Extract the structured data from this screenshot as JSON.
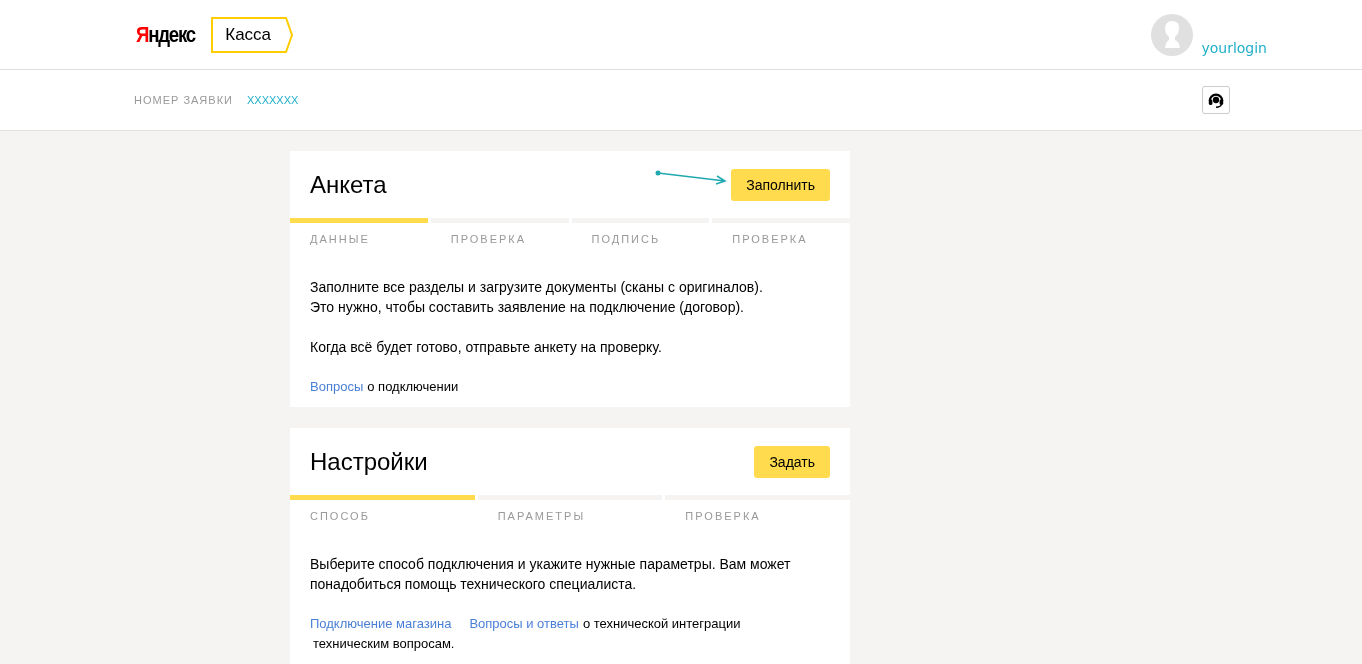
{
  "header": {
    "logo": {
      "first_letter": "Я",
      "rest": "ндекс"
    },
    "service": "Касса",
    "user": {
      "login": "yourlogin"
    }
  },
  "subheader": {
    "label": "НОМЕР ЗАЯВКИ",
    "number": "XXXXXXX"
  },
  "cards": [
    {
      "title": "Анкета",
      "button": "Заполнить",
      "annotated": true,
      "steps": [
        {
          "label": "ДАННЫЕ",
          "active": true
        },
        {
          "label": "ПРОВЕРКА",
          "active": false
        },
        {
          "label": "ПОДПИСЬ",
          "active": false
        },
        {
          "label": "ПРОВЕРКА",
          "active": false
        }
      ],
      "paragraphs": [
        [
          "Заполните все разделы и загрузите документы (сканы с оригиналов).",
          "Это нужно, чтобы составить заявление на подключение (договор)."
        ],
        [
          "Когда всё будет готово, отправьте анкету на проверку."
        ]
      ],
      "link_lines": [
        [
          {
            "kind": "link",
            "text": "Вопросы"
          },
          {
            "kind": "text",
            "text": "о подключении"
          }
        ]
      ]
    },
    {
      "title": "Настройки",
      "button": "Задать",
      "annotated": false,
      "steps": [
        {
          "label": "СПОСОБ",
          "active": true
        },
        {
          "label": "ПАРАМЕТРЫ",
          "active": false
        },
        {
          "label": "ПРОВЕРКА",
          "active": false
        }
      ],
      "paragraphs": [
        [
          "Выберите способ подключения и укажите нужные параметры. Вам может",
          "понадобиться помощь технического специалиста."
        ]
      ],
      "link_lines": [
        [
          {
            "kind": "link",
            "text": "Подключение магазина"
          },
          {
            "kind": "link",
            "text": "Вопросы и ответы"
          },
          {
            "kind": "text",
            "text": "о технической интеграции"
          }
        ],
        [
          {
            "kind": "text",
            "text": "техническим вопросам."
          }
        ]
      ]
    }
  ]
}
